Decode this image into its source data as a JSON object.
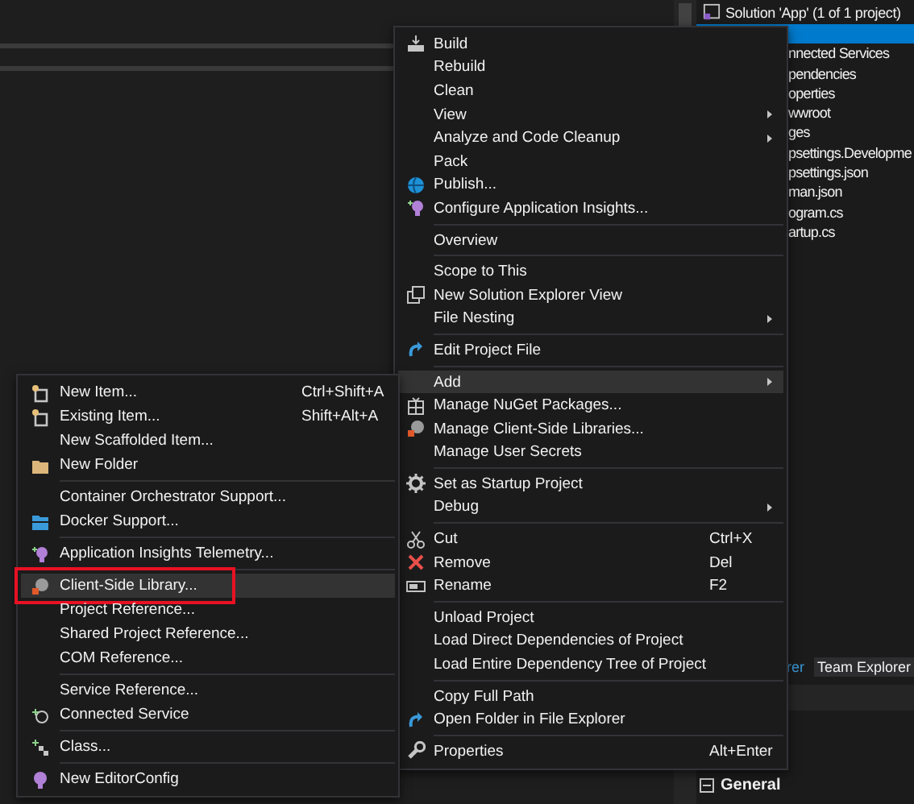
{
  "solution_explorer": {
    "title": "Solution 'App' (1 of 1 project)",
    "items": [
      {
        "selected": true
      },
      {
        "label": "nnected Services",
        "selected": false
      },
      {
        "label": "pendencies",
        "selected": false
      },
      {
        "label": "operties",
        "selected": false
      },
      {
        "label": "wwroot",
        "selected": false
      },
      {
        "label": "ges",
        "selected": false
      },
      {
        "label": "psettings.Developme",
        "selected": false
      },
      {
        "label": "psettings.json",
        "selected": false
      },
      {
        "label": "man.json",
        "selected": false
      },
      {
        "label": "ogram.cs",
        "selected": false
      },
      {
        "label": "artup.cs",
        "selected": false
      }
    ]
  },
  "tabs": [
    {
      "label": "rer",
      "selected": true
    },
    {
      "label": "Team Explorer",
      "selected": false
    }
  ],
  "properties": {
    "section": "General",
    "expanded": true
  },
  "context_menu": {
    "items": [
      {
        "kind": "item",
        "label": "Build",
        "selected": false
      },
      {
        "kind": "item",
        "label": "Rebuild",
        "selected": false
      },
      {
        "kind": "item",
        "label": "Clean",
        "selected": false
      },
      {
        "kind": "item",
        "label": "View",
        "submenu": true,
        "selected": false
      },
      {
        "kind": "item",
        "label": "Analyze and Code Cleanup",
        "submenu": true,
        "selected": false
      },
      {
        "kind": "item",
        "label": "Pack",
        "selected": false
      },
      {
        "kind": "item",
        "label": "Publish...",
        "selected": false
      },
      {
        "kind": "item",
        "label": "Configure Application Insights...",
        "selected": false
      },
      {
        "kind": "separator"
      },
      {
        "kind": "item",
        "label": "Overview",
        "selected": false
      },
      {
        "kind": "separator"
      },
      {
        "kind": "item",
        "label": "Scope to This",
        "selected": false
      },
      {
        "kind": "item",
        "label": "New Solution Explorer View",
        "selected": false
      },
      {
        "kind": "item",
        "label": "File Nesting",
        "submenu": true,
        "selected": false
      },
      {
        "kind": "separator"
      },
      {
        "kind": "item",
        "label": "Edit Project File",
        "selected": false
      },
      {
        "kind": "separator"
      },
      {
        "kind": "item",
        "label": "Add",
        "submenu": true,
        "selected": true
      },
      {
        "kind": "item",
        "label": "Manage NuGet Packages...",
        "selected": false
      },
      {
        "kind": "item",
        "label": "Manage Client-Side Libraries...",
        "selected": false
      },
      {
        "kind": "item",
        "label": "Manage User Secrets",
        "selected": false
      },
      {
        "kind": "separator"
      },
      {
        "kind": "item",
        "label": "Set as Startup Project",
        "selected": false
      },
      {
        "kind": "item",
        "label": "Debug",
        "submenu": true,
        "selected": false
      },
      {
        "kind": "separator"
      },
      {
        "kind": "item",
        "label": "Cut",
        "shortcut": "Ctrl+X",
        "selected": false
      },
      {
        "kind": "item",
        "label": "Remove",
        "shortcut": "Del",
        "selected": false
      },
      {
        "kind": "item",
        "label": "Rename",
        "shortcut": "F2",
        "selected": false
      },
      {
        "kind": "separator"
      },
      {
        "kind": "item",
        "label": "Unload Project",
        "selected": false
      },
      {
        "kind": "item",
        "label": "Load Direct Dependencies of Project",
        "selected": false
      },
      {
        "kind": "item",
        "label": "Load Entire Dependency Tree of Project",
        "selected": false
      },
      {
        "kind": "separator"
      },
      {
        "kind": "item",
        "label": "Copy Full Path",
        "selected": false
      },
      {
        "kind": "item",
        "label": "Open Folder in File Explorer",
        "selected": false
      },
      {
        "kind": "separator"
      },
      {
        "kind": "item",
        "label": "Properties",
        "shortcut": "Alt+Enter",
        "selected": false
      }
    ]
  },
  "add_submenu": {
    "items": [
      {
        "kind": "item",
        "label": "New Item...",
        "shortcut": "Ctrl+Shift+A",
        "selected": false
      },
      {
        "kind": "item",
        "label": "Existing Item...",
        "shortcut": "Shift+Alt+A",
        "selected": false
      },
      {
        "kind": "item",
        "label": "New Scaffolded Item...",
        "selected": false
      },
      {
        "kind": "item",
        "label": "New Folder",
        "selected": false
      },
      {
        "kind": "separator"
      },
      {
        "kind": "item",
        "label": "Container Orchestrator Support...",
        "selected": false
      },
      {
        "kind": "item",
        "label": "Docker Support...",
        "selected": false
      },
      {
        "kind": "separator"
      },
      {
        "kind": "item",
        "label": "Application Insights Telemetry...",
        "selected": false
      },
      {
        "kind": "separator"
      },
      {
        "kind": "item",
        "label": "Client-Side Library...",
        "selected": true,
        "outlined": true
      },
      {
        "kind": "item",
        "label": "Project Reference...",
        "selected": false
      },
      {
        "kind": "item",
        "label": "Shared Project Reference...",
        "selected": false
      },
      {
        "kind": "item",
        "label": "COM Reference...",
        "selected": false
      },
      {
        "kind": "separator"
      },
      {
        "kind": "item",
        "label": "Service Reference...",
        "selected": false
      },
      {
        "kind": "item",
        "label": "Connected Service",
        "selected": false
      },
      {
        "kind": "separator"
      },
      {
        "kind": "item",
        "label": "Class...",
        "selected": false
      },
      {
        "kind": "separator"
      },
      {
        "kind": "item",
        "label": "New EditorConfig",
        "selected": false
      }
    ]
  }
}
